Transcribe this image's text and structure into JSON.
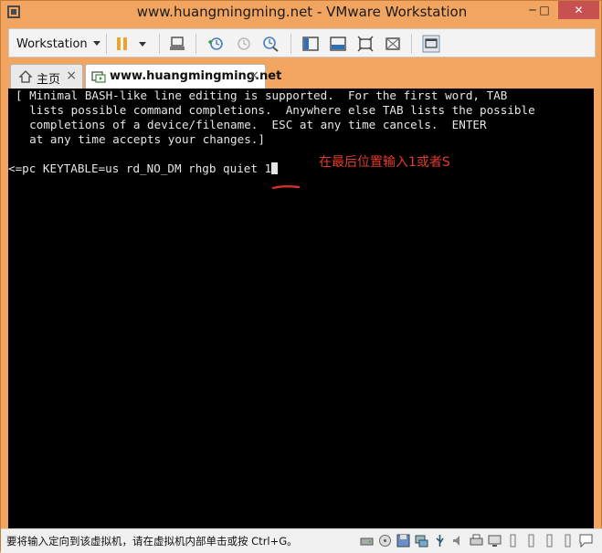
{
  "window": {
    "title": "www.huangmingming.net - VMware Workstation",
    "minimize": "─",
    "maximize": "□",
    "close": "✕"
  },
  "toolbar": {
    "workstation_label": "Workstation"
  },
  "tabs": [
    {
      "label": "主页",
      "icon": "home-icon"
    },
    {
      "label": "www.huangmingming.net",
      "icon": "vm-icon",
      "active": true
    }
  ],
  "console": {
    "help_lines": [
      "[ Minimal BASH-like line editing is supported.  For the first word, TAB",
      "  lists possible command completions.  Anywhere else TAB lists the possible",
      "  completions of a device/filename.  ESC at any time cancels.  ENTER",
      "  at any time accepts your changes.]"
    ],
    "command": "<=pc KEYTABLE=us rd_NO_DM rhgb quiet 1",
    "annotation": "在最后位置输入1或者S",
    "annotation_color": "#e33a2a"
  },
  "statusbar": {
    "text": "要将输入定向到该虚拟机，请在虚拟机内部单击或按 Ctrl+G。"
  },
  "colors": {
    "frame": "#f2a560",
    "console_bg": "#000000",
    "console_fg": "#e6e6e6"
  }
}
